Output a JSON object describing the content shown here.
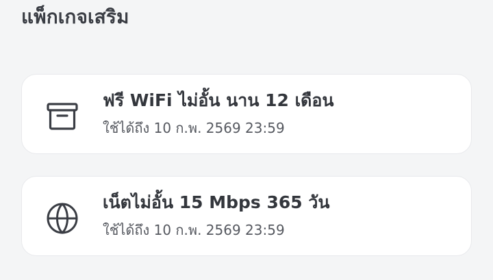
{
  "section": {
    "title": "แพ็กเกจเสริม"
  },
  "packages": [
    {
      "icon": "archive-box-icon",
      "title": "ฟรี WiFi ไม่อั้น นาน 12 เดือน",
      "validity": "ใช้ได้ถึง 10 ก.พ. 2569 23:59"
    },
    {
      "icon": "globe-icon",
      "title": "เน็ตไม่อั้น 15 Mbps 365 วัน",
      "validity": "ใช้ได้ถึง 10 ก.พ. 2569 23:59"
    }
  ]
}
